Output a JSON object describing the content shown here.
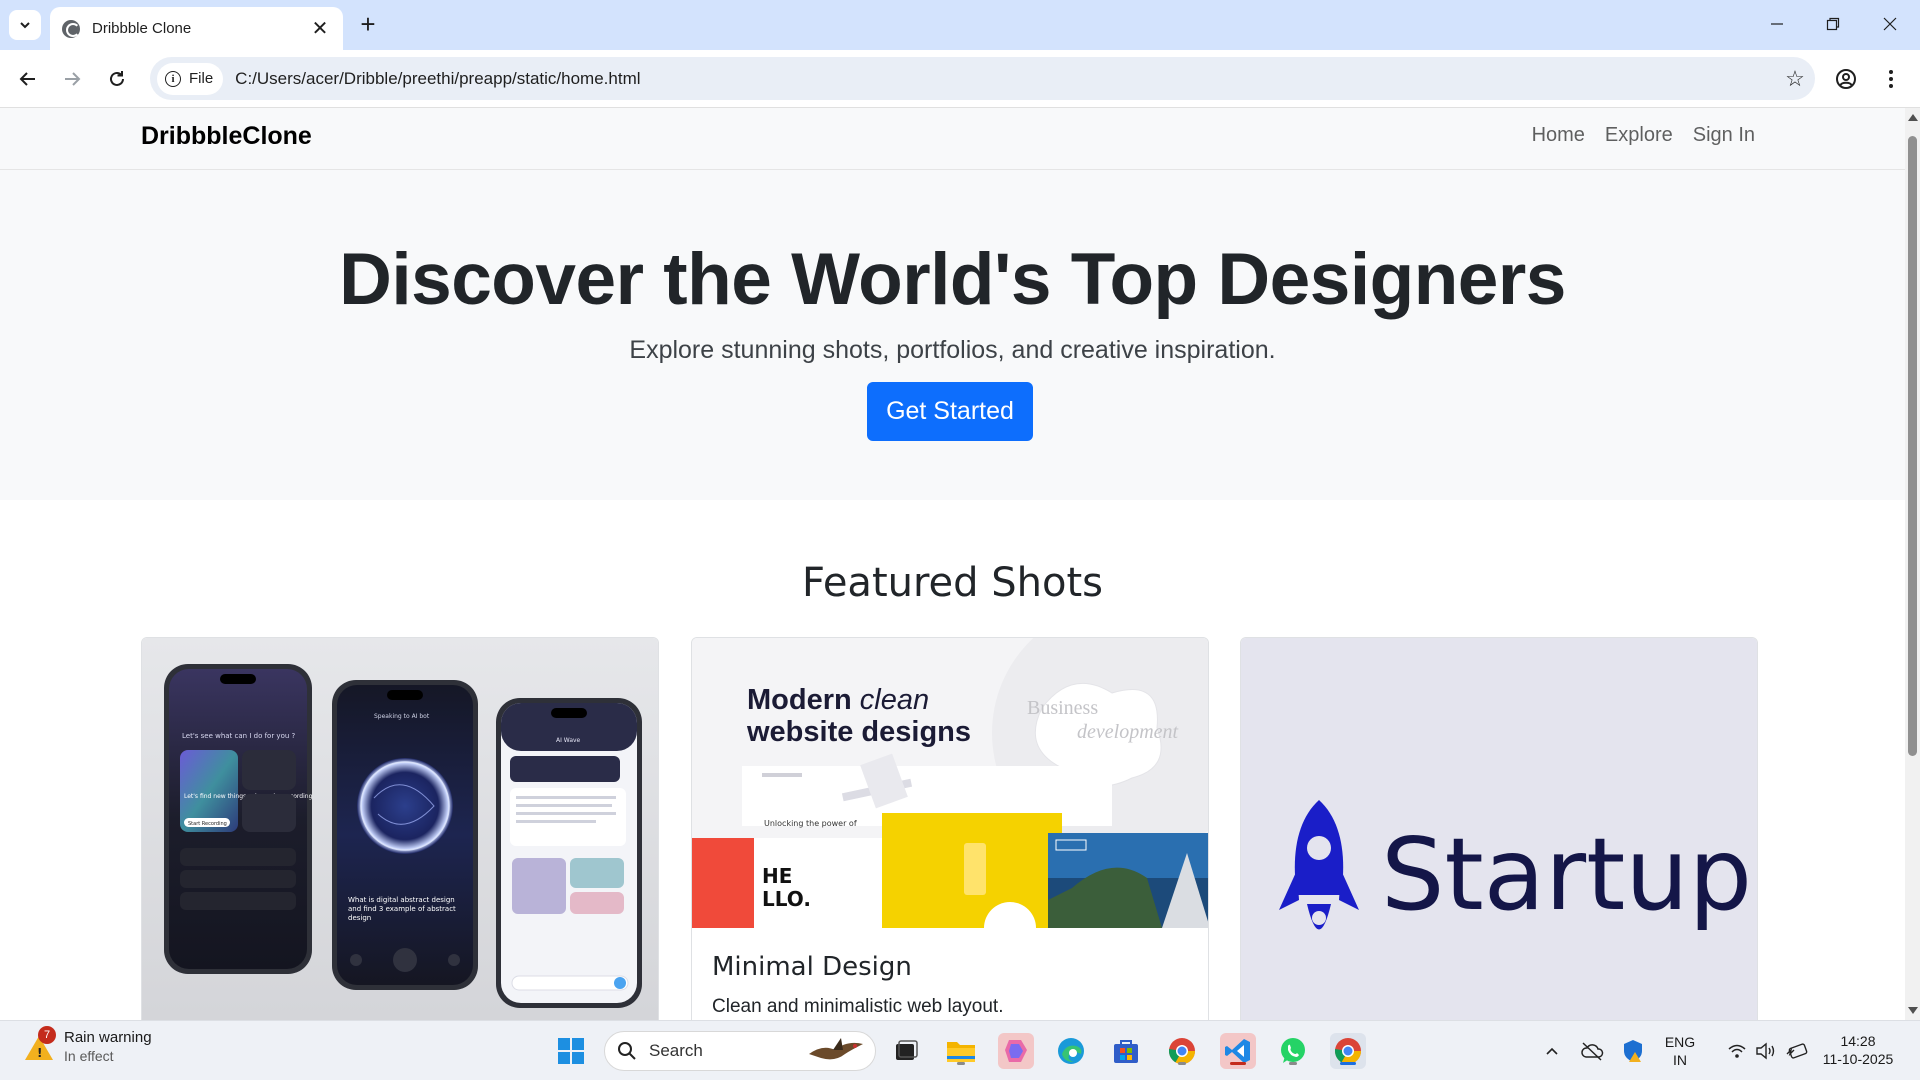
{
  "browser": {
    "tab_title": "Dribbble Clone",
    "file_chip": "File",
    "url": "C:/Users/acer/Dribble/preethi/preapp/static/home.html"
  },
  "site": {
    "brand": "DribbbleClone",
    "nav": [
      {
        "label": "Home"
      },
      {
        "label": "Explore"
      },
      {
        "label": "Sign In"
      }
    ]
  },
  "hero": {
    "title": "Discover the World's Top Designers",
    "subtitle": "Explore stunning shots, portfolios, and creative inspiration.",
    "cta": "Get Started",
    "cta_color": "#0d6efd"
  },
  "featured": {
    "title": "Featured Shots",
    "cards": [
      {
        "image": {
          "phone1_greeting": "Let's see what can I do for you ?",
          "phone1_card": "Let's find new things using voice recording",
          "phone1_button": "Start Recording",
          "phone2_header": "Speaking to AI bot",
          "phone2_text": "What is digital abstract design and find 3 example of abstract design",
          "phone3_header": "AI Wave"
        }
      },
      {
        "image": {
          "headline_bold_1": "Modern",
          "headline_italic": "clean",
          "headline_bold_2": "website designs",
          "side_text_1": "Business",
          "side_text_2": "development",
          "tile_text": "HE LLO."
        },
        "title": "Minimal Design",
        "text": "Clean and minimalistic web layout."
      },
      {
        "image": {
          "logo_text": "Startup"
        }
      }
    ]
  },
  "taskbar": {
    "weather_title": "Rain warning",
    "weather_sub": "In effect",
    "weather_badge": "7",
    "search_label": "Search",
    "lang_1": "ENG",
    "lang_2": "IN",
    "time": "14:28",
    "date": "11-10-2025"
  }
}
